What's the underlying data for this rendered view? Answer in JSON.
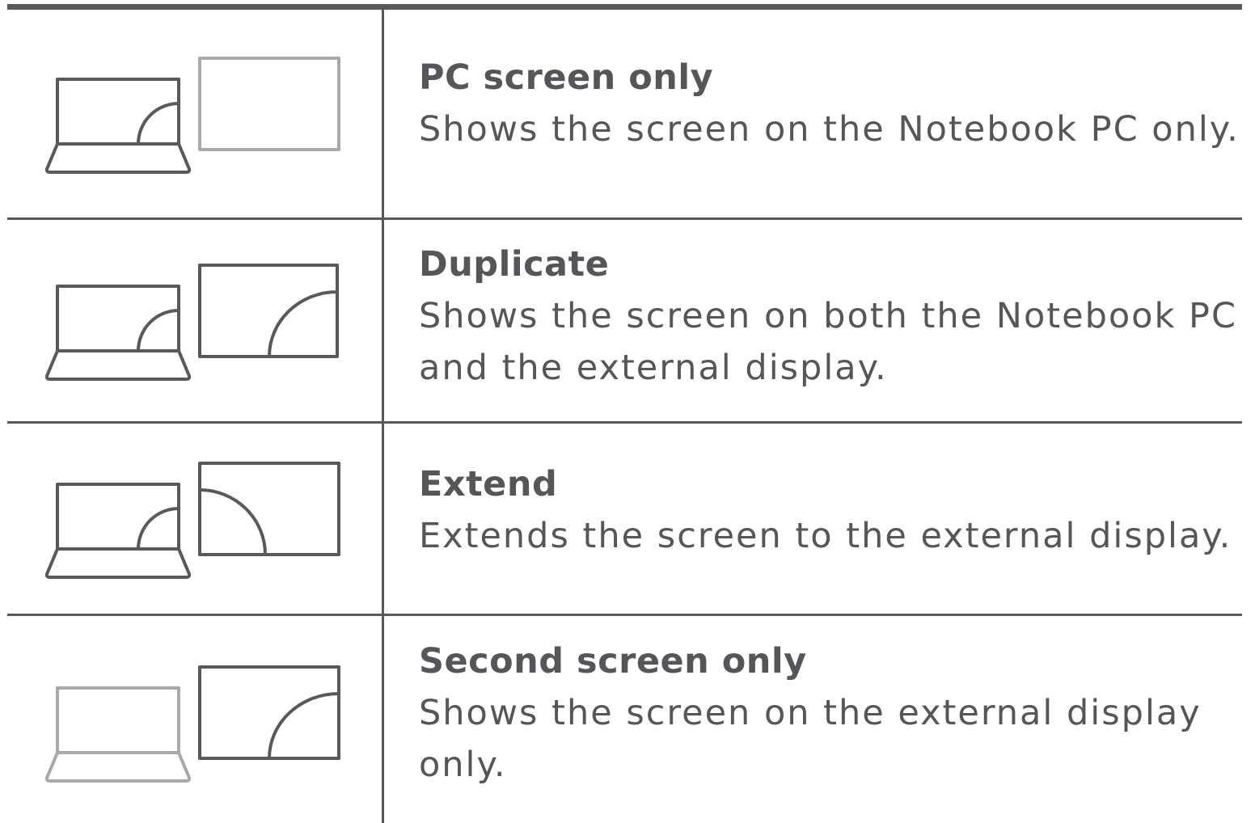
{
  "modes": [
    {
      "icon": "pc-screen-only-icon",
      "title": "PC screen only",
      "desc_lines": [
        "Shows the screen on the Notebook PC only."
      ]
    },
    {
      "icon": "duplicate-icon",
      "title": "Duplicate",
      "desc_lines": [
        "Shows the screen on both the Notebook PC",
        "and the external display."
      ]
    },
    {
      "icon": "extend-icon",
      "title": "Extend",
      "desc_lines": [
        "Extends the screen to the external display."
      ]
    },
    {
      "icon": "second-screen-only-icon",
      "title": "Second screen only",
      "desc_lines": [
        "Shows the screen on the external display",
        "only."
      ]
    }
  ],
  "colors": {
    "line": "#58595b",
    "text": "#555659",
    "active_icon": "#58595b",
    "inactive_icon": "#a7a9ac"
  }
}
